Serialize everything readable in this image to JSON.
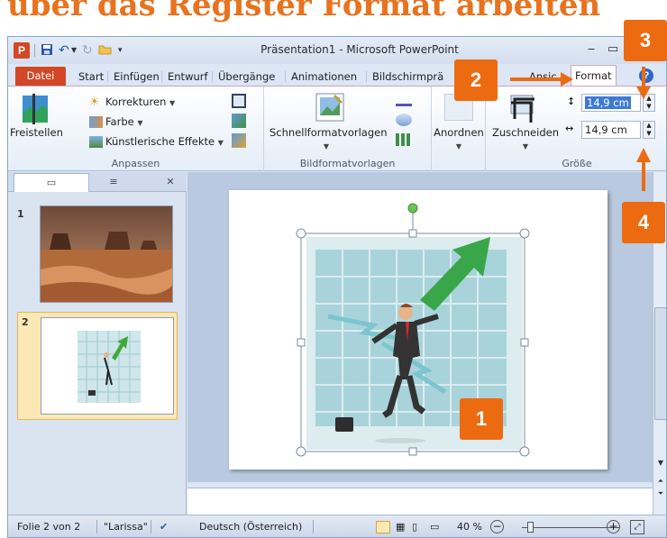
{
  "heading": "über das Register Format arbeiten",
  "window": {
    "title": "Präsentation1 - Microsoft PowerPoint",
    "app_logo": "P"
  },
  "tabs": {
    "datei": "Datei",
    "start": "Start",
    "einfuegen": "Einfügen",
    "entwurf": "Entwurf",
    "uebergaenge": "Übergänge",
    "animationen": "Animationen",
    "bildschirm": "Bildschirmprä",
    "ansicht_fragment": "Ansic",
    "format": "Format"
  },
  "ribbon": {
    "freistellen": "Freistellen",
    "korrekturen": "Korrekturen",
    "farbe": "Farbe",
    "kuenstlerische": "Künstlerische Effekte",
    "anpassen_label": "Anpassen",
    "schnellformat": "Schnellformatvorlagen",
    "bildformat_label": "Bildformatvorlagen",
    "anordnen": "Anordnen",
    "zuschneiden": "Zuschneiden",
    "groesse_label": "Größe",
    "height_value": "14,9 cm",
    "width_value": "14,9 cm"
  },
  "slides_panel": {
    "slide1_number": "1",
    "slide2_number": "2"
  },
  "statusbar": {
    "folie": "Folie 2 von 2",
    "theme": "\"Larissa\"",
    "language": "Deutsch (Österreich)",
    "zoom": "40 %"
  },
  "callouts": {
    "c1": "1",
    "c2": "2",
    "c3": "3",
    "c4": "4"
  },
  "colors": {
    "accent_orange": "#ec6b11",
    "datei_tab": "#d24726",
    "selection_blue": "#3d7ad6"
  }
}
